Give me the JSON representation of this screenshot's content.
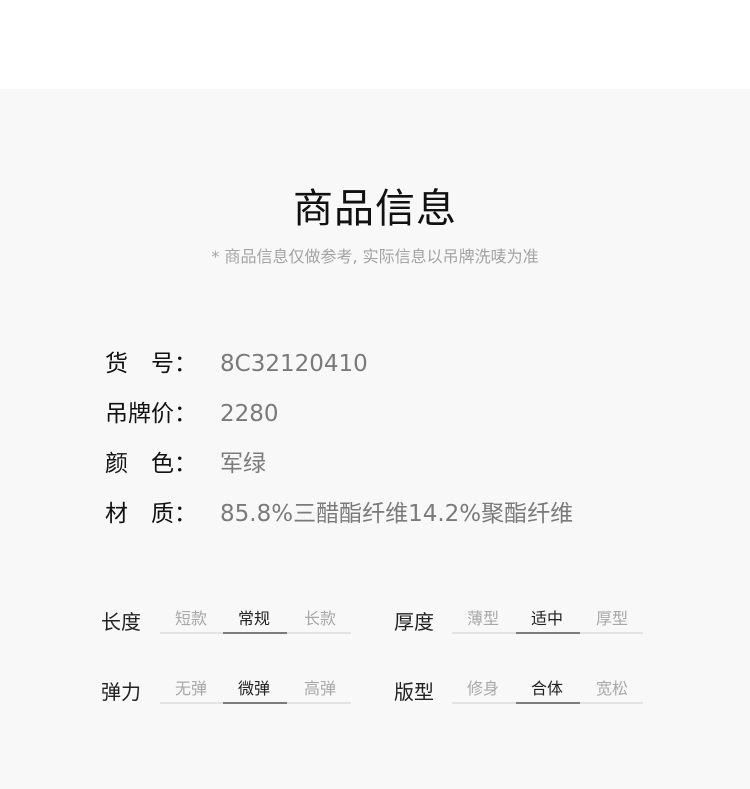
{
  "header": {
    "title": "商品信息",
    "subtitle": "* 商品信息仅做参考, 实际信息以吊牌洗唛为准"
  },
  "info": [
    {
      "label": "货　号：",
      "value": "8C32120410"
    },
    {
      "label": "吊牌价：",
      "value": "2280"
    },
    {
      "label": "颜　色：",
      "value": "军绿"
    },
    {
      "label": "材　质：",
      "value": "85.8%三醋酯纤维14.2%聚酯纤维"
    }
  ],
  "attributes": {
    "length": {
      "label": "长度",
      "options": [
        "短款",
        "常规",
        "长款"
      ],
      "selected": "常规"
    },
    "thickness": {
      "label": "厚度",
      "options": [
        "薄型",
        "适中",
        "厚型"
      ],
      "selected": "适中"
    },
    "elasticity": {
      "label": "弹力",
      "options": [
        "无弹",
        "微弹",
        "高弹"
      ],
      "selected": "微弹"
    },
    "fit": {
      "label": "版型",
      "options": [
        "修身",
        "合体",
        "宽松"
      ],
      "selected": "合体"
    }
  }
}
